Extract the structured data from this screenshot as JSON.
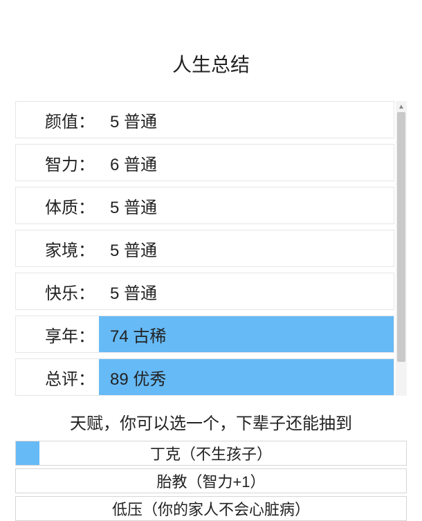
{
  "title": "人生总结",
  "stats": [
    {
      "label": "颜值：",
      "num": "5",
      "desc": "普通",
      "highlight": false
    },
    {
      "label": "智力：",
      "num": "6",
      "desc": "普通",
      "highlight": false
    },
    {
      "label": "体质：",
      "num": "5",
      "desc": "普通",
      "highlight": false
    },
    {
      "label": "家境：",
      "num": "5",
      "desc": "普通",
      "highlight": false
    },
    {
      "label": "快乐：",
      "num": "5",
      "desc": "普通",
      "highlight": false
    },
    {
      "label": "享年：",
      "num": "74",
      "desc": "古稀",
      "highlight": true
    },
    {
      "label": "总评：",
      "num": "89",
      "desc": "优秀",
      "highlight": true
    }
  ],
  "talent_prompt": "天赋，你可以选一个，下辈子还能抽到",
  "talents": [
    {
      "name": "丁克（不生孩子）",
      "selected": true
    },
    {
      "name": "胎教（智力+1）",
      "selected": false
    },
    {
      "name": "低压（你的家人不会心脏病）",
      "selected": false
    }
  ]
}
